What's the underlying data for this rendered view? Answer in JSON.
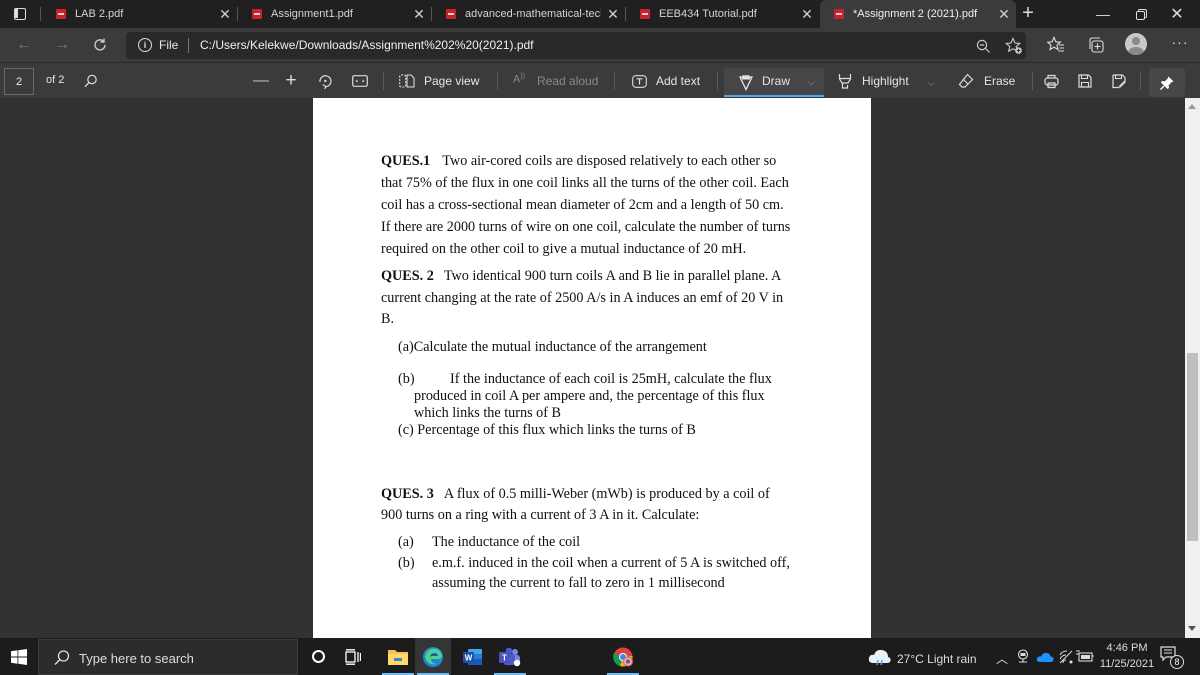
{
  "browser": {
    "tabs": [
      {
        "label": "LAB 2.pdf",
        "active": false
      },
      {
        "label": "Assignment1.pdf",
        "active": false
      },
      {
        "label": "advanced-mathematical-tech",
        "active": false
      },
      {
        "label": "EEB434 Tutorial.pdf",
        "active": false
      },
      {
        "label": "*Assignment 2 (2021).pdf",
        "active": true
      }
    ],
    "new_tab_glyph": "+",
    "address": {
      "scheme_label": "File",
      "url": "C:/Users/Kelekwe/Downloads/Assignment%202%20(2021).pdf"
    }
  },
  "pdf_toolbar": {
    "current_page": "2",
    "page_count_label": "of 2",
    "page_view_label": "Page view",
    "read_aloud_label": "Read aloud",
    "add_text_label": "Add text",
    "draw_label": "Draw",
    "highlight_label": "Highlight",
    "erase_label": "Erase",
    "draw_color": "#4ea6f5"
  },
  "document": {
    "q1": {
      "heading": "QUES.1",
      "lines": [
        "Two air-cored coils are disposed relatively to each other so",
        "that 75% of the flux in one coil links all the turns of the other coil. Each",
        "coil has a cross-sectional mean diameter of 2cm and a length of 50 cm.",
        "If there are 2000 turns of wire on one coil, calculate the number of turns",
        "required on the other coil to give a mutual inductance of 20 mH."
      ]
    },
    "q2": {
      "heading": "QUES. 2",
      "lines": [
        "Two identical 900 turn coils A and B lie in parallel plane. A",
        "current changing at the rate of 2500 A/s in A induces an emf of 20 V in",
        "B."
      ],
      "part_a": "(a)Calculate the mutual inductance of the arrangement",
      "part_b_label": "(b)",
      "part_b_lines": [
        "If the inductance of each coil is 25mH, calculate the flux",
        "produced in coil A per ampere and,   the percentage of this flux",
        "which links the turns of B"
      ],
      "part_c": "(c) Percentage of this flux which links the turns of B"
    },
    "q3": {
      "heading": "QUES. 3",
      "lines": [
        "A flux of 0.5 milli-Weber (mWb) is produced by a coil of",
        "900 turns on a ring with a current of 3 A in it. Calculate:"
      ],
      "part_a_label": "(a)",
      "part_a": "The inductance of the coil",
      "part_b_label": "(b)",
      "part_b_lines": [
        "e.m.f. induced in the coil when a current of 5 A is switched off,",
        "assuming the current to fall to zero in 1 millisecond"
      ]
    }
  },
  "taskbar": {
    "search_placeholder": "Type here to search",
    "weather": "27°C  Light rain",
    "time": "4:46 PM",
    "date": "11/25/2021",
    "notification_count": "8"
  }
}
